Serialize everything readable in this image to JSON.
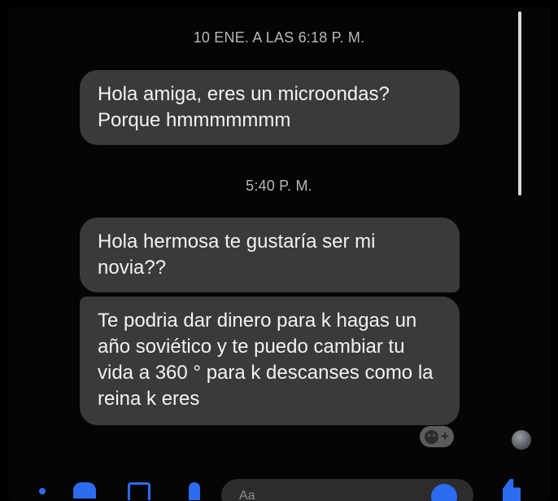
{
  "conversation": {
    "timestamps": [
      "10 ENE. A LAS 6:18 P. M.",
      "5:40 P. M."
    ],
    "messages": [
      {
        "text": "Hola amiga, eres un microondas? Porque hmmmmmmm"
      },
      {
        "text": "Hola hermosa te gustaría ser mi novia??"
      },
      {
        "text": "Te podria dar dinero para k hagas un año soviético y te puedo cambiar tu vida a 360 ° para k descanses como la reina k eres"
      }
    ],
    "reaction_add_label": "+"
  },
  "composer": {
    "placeholder": "Aa"
  },
  "colors": {
    "background": "#000000",
    "bubble": "#3a3a3c",
    "accent": "#2d6cf0",
    "timestamp": "#b8b8b8"
  },
  "icons": [
    "menu-dot-icon",
    "camera-icon",
    "image-icon",
    "mic-icon",
    "emoji-icon",
    "like-icon",
    "add-reaction-icon",
    "seen-avatar-icon"
  ]
}
